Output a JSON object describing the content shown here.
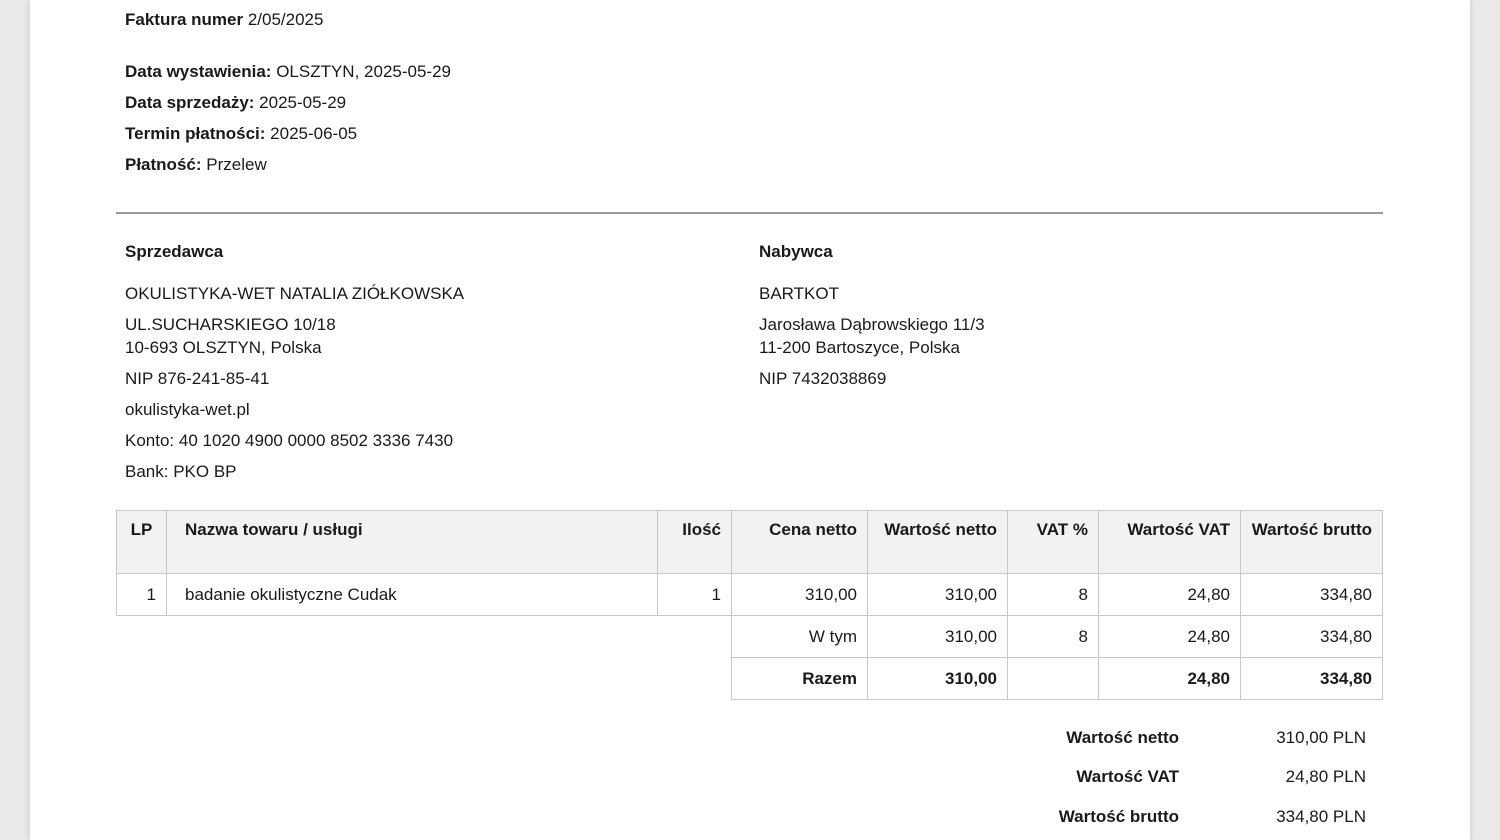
{
  "invoice": {
    "number_label": "Faktura numer",
    "number": "2/05/2025",
    "issue_label": "Data wystawienia:",
    "issue_value": "OLSZTYN, 2025-05-29",
    "sale_label": "Data sprzedaży:",
    "sale_value": "2025-05-29",
    "due_label": "Termin płatności:",
    "due_value": "2025-06-05",
    "payment_label": "Płatność:",
    "payment_value": "Przelew"
  },
  "seller": {
    "heading": "Sprzedawca",
    "name": "OKULISTYKA-WET NATALIA ZIÓŁKOWSKA",
    "street": "UL.SUCHARSKIEGO 10/18",
    "city": "10-693 OLSZTYN, Polska",
    "nip": "NIP 876-241-85-41",
    "website": "okulistyka-wet.pl",
    "account": "Konto: 40 1020 4900 0000 8502 3336 7430",
    "bank": "Bank: PKO BP"
  },
  "buyer": {
    "heading": "Nabywca",
    "name": "BARTKOT",
    "street": "Jarosława Dąbrowskiego 11/3",
    "city": "11-200 Bartoszyce, Polska",
    "nip": "NIP 7432038869"
  },
  "table": {
    "headers": [
      "LP",
      "Nazwa towaru / usługi",
      "Ilość",
      "Cena netto",
      "Wartość netto",
      "VAT %",
      "Wartość VAT",
      "Wartość brutto"
    ],
    "rows": [
      {
        "lp": "1",
        "name": "badanie okulistyczne Cudak",
        "qty": "1",
        "price": "310,00",
        "net": "310,00",
        "vat_pct": "8",
        "vat": "24,80",
        "gross": "334,80"
      }
    ],
    "wtym": {
      "label": "W tym",
      "net": "310,00",
      "vat_pct": "8",
      "vat": "24,80",
      "gross": "334,80"
    },
    "razem": {
      "label": "Razem",
      "net": "310,00",
      "vat": "24,80",
      "gross": "334,80"
    }
  },
  "summary": {
    "net_label": "Wartość netto",
    "net_value": "310,00 PLN",
    "vat_label": "Wartość VAT",
    "vat_value": "24,80 PLN",
    "gross_label": "Wartość brutto",
    "gross_value": "334,80 PLN"
  }
}
